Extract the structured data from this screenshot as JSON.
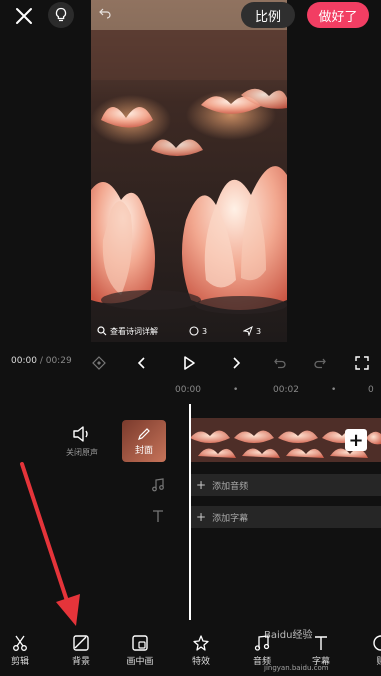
{
  "topbar": {
    "ratio_label": "比例",
    "done_label": "做好了"
  },
  "preview": {
    "overlay_link_text": "查看诗词详解",
    "comment_count": "3",
    "share_count": "3"
  },
  "playback": {
    "current_time": "00:00",
    "separator": "/",
    "total_time": "00:29"
  },
  "ruler": {
    "mark_1": "00:00",
    "mark_2": "00:02",
    "dot": "•"
  },
  "left_tools": {
    "mute_label": "关闭原声",
    "cover_label": "封面"
  },
  "tracks": {
    "audio_label": "添加音频",
    "subtitle_label": "添加字幕"
  },
  "nav": {
    "items": [
      {
        "label": "剪辑",
        "icon": "scissors-icon"
      },
      {
        "label": "背景",
        "icon": "background-icon"
      },
      {
        "label": "画中画",
        "icon": "pip-icon"
      },
      {
        "label": "特效",
        "icon": "effects-icon"
      },
      {
        "label": "音频",
        "icon": "music-icon"
      },
      {
        "label": "字幕",
        "icon": "text-icon"
      },
      {
        "label": "贴",
        "icon": "sticker-icon"
      }
    ]
  },
  "watermark": {
    "text": "Baidu经验",
    "url": "jingyan.baidu.com"
  },
  "colors": {
    "accent": "#f23e63",
    "arrow": "#e5343a"
  }
}
